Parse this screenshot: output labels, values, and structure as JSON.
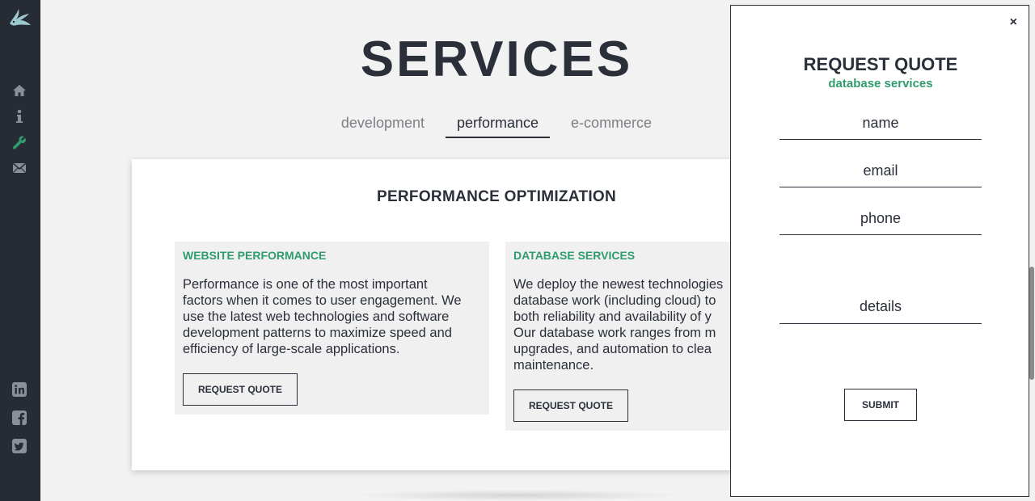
{
  "sidebar": {
    "logo_icon": "bird-logo-icon",
    "nav": [
      {
        "icon": "home-icon"
      },
      {
        "icon": "info-icon"
      },
      {
        "icon": "wrench-icon",
        "active": true,
        "color": "#2f9b6e"
      },
      {
        "icon": "envelope-icon"
      }
    ],
    "social": [
      {
        "icon": "linkedin-icon"
      },
      {
        "icon": "facebook-icon"
      },
      {
        "icon": "twitter-icon"
      }
    ]
  },
  "main": {
    "title": "SERVICES",
    "tabs": [
      {
        "label": "development"
      },
      {
        "label": "performance",
        "active": true
      },
      {
        "label": "e-commerce"
      }
    ],
    "card": {
      "title": "PERFORMANCE OPTIMIZATION",
      "panels": [
        {
          "heading": "WEBSITE PERFORMANCE",
          "lines": [
            "Performance is one of the most important",
            "factors when it comes to user engagement. We",
            "use the latest web technologies and software",
            "development patterns to maximize speed and",
            "efficiency of large-scale applications."
          ],
          "button": "REQUEST QUOTE"
        },
        {
          "heading": "DATABASE SERVICES",
          "lines": [
            "We deploy the newest technologies",
            "database work (including cloud) to",
            "both reliability and availability of y",
            "Our database work ranges from m",
            "upgrades, and automation to clea",
            "maintenance."
          ],
          "button": "REQUEST QUOTE"
        }
      ]
    }
  },
  "modal": {
    "close_label": "×",
    "title": "REQUEST QUOTE",
    "subtitle": "database services",
    "fields": {
      "name_placeholder": "name",
      "email_placeholder": "email",
      "phone_placeholder": "phone",
      "details_placeholder": "details"
    },
    "submit_label": "SUBMIT"
  },
  "colors": {
    "sidebar_bg": "#272b33",
    "accent_green": "#2f9b6e",
    "text_dark": "#2a2f3a"
  }
}
